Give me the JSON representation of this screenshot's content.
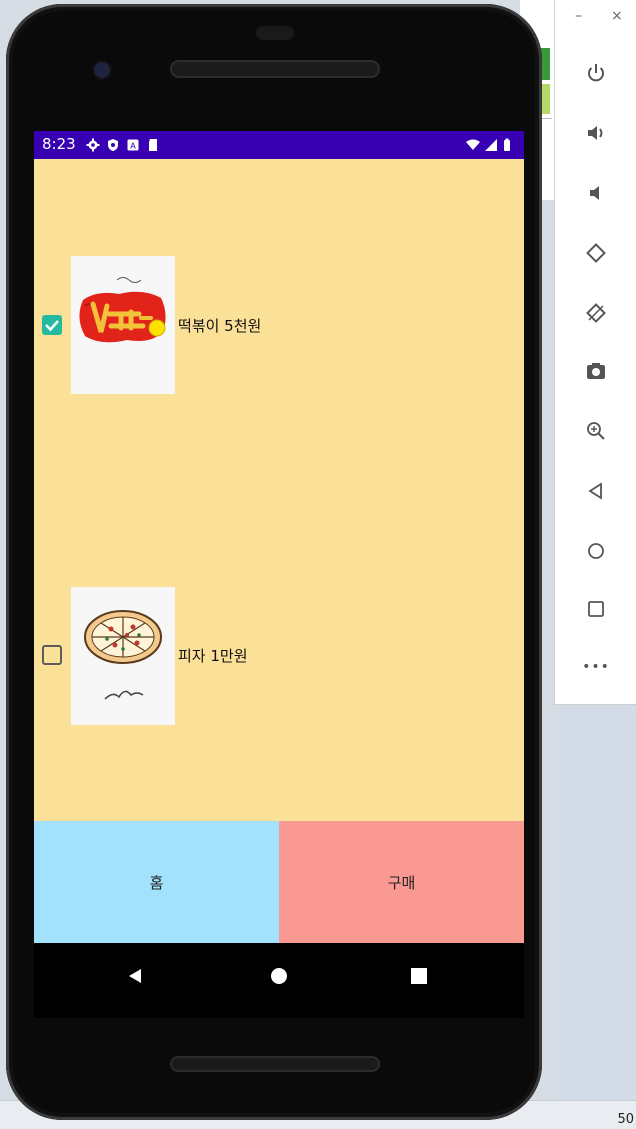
{
  "status_bar": {
    "time": "8:23"
  },
  "items": [
    {
      "label": "떡볶이 5천원",
      "checked": true,
      "image": "tteokbokki-drawing"
    },
    {
      "label": "피자 1만원",
      "checked": false,
      "image": "pizza-drawing"
    }
  ],
  "buttons": {
    "home": "홈",
    "buy": "구매"
  },
  "window_controls": {
    "minimize": "–",
    "close": "×"
  },
  "toolbar_icons": [
    "power-icon",
    "volume-up-icon",
    "volume-down-icon",
    "rotate-left-icon",
    "rotate-right-icon",
    "camera-icon",
    "zoom-icon",
    "back-icon",
    "home-icon",
    "overview-icon",
    "more-icon"
  ],
  "toolbar_more": "•••",
  "desktop_number": "50",
  "colors": {
    "status_bar": "#3700b3",
    "content_bg": "#fbe098",
    "home_button": "#a3e2fc",
    "buy_button": "#fa9892",
    "checkbox_checked": "#25b9a0"
  }
}
